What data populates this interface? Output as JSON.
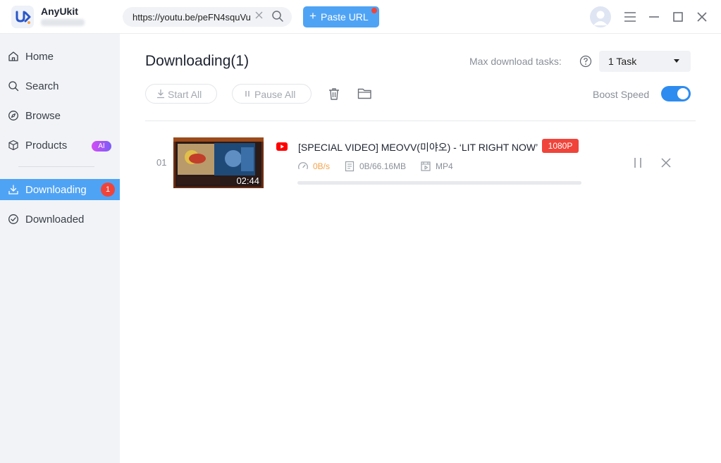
{
  "app": {
    "name": "AnyUkit"
  },
  "header": {
    "url_value": "https://youtu.be/peFN4squVu",
    "paste_label": "Paste URL"
  },
  "sidebar": {
    "items": [
      {
        "label": "Home",
        "icon": "home-icon"
      },
      {
        "label": "Search",
        "icon": "search-icon"
      },
      {
        "label": "Browse",
        "icon": "compass-icon"
      },
      {
        "label": "Products",
        "icon": "box-icon",
        "badge": "AI"
      },
      {
        "label": "Downloading",
        "icon": "download-icon",
        "badge": "1"
      },
      {
        "label": "Downloaded",
        "icon": "check-circle-icon"
      }
    ],
    "active_index": 4
  },
  "main": {
    "title": "Downloading(1)",
    "max_tasks_label": "Max download tasks:",
    "max_tasks_value": "1 Task",
    "start_all_label": "Start All",
    "pause_all_label": "Pause All",
    "boost_label": "Boost Speed",
    "boost_enabled": true
  },
  "downloads": [
    {
      "index": "01",
      "title": "[SPECIAL VIDEO] MEOVV(미야오) - ‘LIT RIGHT NOW’",
      "resolution": "1080P",
      "duration": "02:44",
      "speed": "0B/s",
      "size": "0B/66.16MB",
      "format": "MP4",
      "source": "youtube",
      "progress_fraction": 0
    }
  ],
  "colors": {
    "accent": "#4fa3f5",
    "toggle_on": "#2e8cf0",
    "danger": "#f0443a",
    "speed": "#f5a34a",
    "sidebar_bg": "#f1f3f6"
  }
}
